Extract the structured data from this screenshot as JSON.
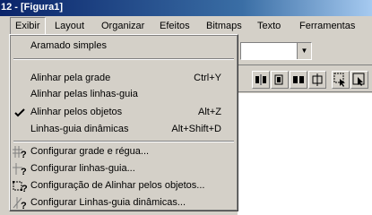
{
  "titlebar": {
    "title": "12 - [Figura1]"
  },
  "menubar": {
    "items": [
      {
        "label": "Exibir"
      },
      {
        "label": "Layout"
      },
      {
        "label": "Organizar"
      },
      {
        "label": "Efeitos"
      },
      {
        "label": "Bitmaps"
      },
      {
        "label": "Texto"
      },
      {
        "label": "Ferramentas"
      }
    ]
  },
  "menu": {
    "items": [
      {
        "label": "Aramado simples",
        "shortcut": ""
      },
      {
        "label": "Alinhar pela grade",
        "shortcut": "Ctrl+Y"
      },
      {
        "label": "Alinhar pelas linhas-guia",
        "shortcut": ""
      },
      {
        "label": "Alinhar pelos objetos",
        "shortcut": "Alt+Z",
        "checked": true
      },
      {
        "label": "Linhas-guia dinâmicas",
        "shortcut": "Alt+Shift+D"
      },
      {
        "label": "Configurar grade e régua...",
        "icon": "grid-settings-icon"
      },
      {
        "label": "Configurar linhas-guia...",
        "icon": "guidelines-settings-icon"
      },
      {
        "label": "Configuração de Alinhar pelos objetos...",
        "icon": "snap-objects-settings-icon"
      },
      {
        "label": "Configurar Linhas-guia dinâmicas...",
        "icon": "dynamic-guides-settings-icon"
      }
    ]
  },
  "colors": {
    "titlebar_start": "#0a246a",
    "titlebar_end": "#a6caf0",
    "face": "#d4d0c8"
  }
}
